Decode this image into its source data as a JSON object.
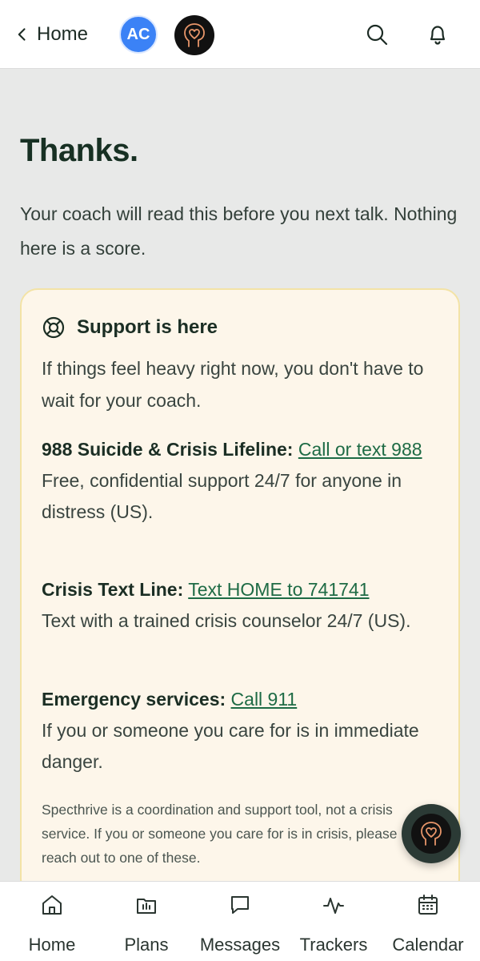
{
  "topbar": {
    "back_label": "Home",
    "avatar_initials": "AC",
    "avatar_color": "#3b82f6",
    "icons": [
      "chevron-left-icon",
      "search-icon",
      "bell-icon"
    ]
  },
  "main": {
    "title": "Thanks.",
    "subtitle": "Your coach will read this before you next talk. Nothing here is a score."
  },
  "support_card": {
    "title": "Support is here",
    "intro": "If things feel heavy right now, you don't have to wait for your coach.",
    "resources": [
      {
        "label": "988 Suicide & Crisis Lifeline:",
        "link": "Call or text 988",
        "description": "Free, confidential support 24/7 for anyone in distress (US)."
      },
      {
        "label": "Crisis Text Line:",
        "link": "Text HOME to 741741",
        "description": "Text with a trained crisis counselor 24/7 (US)."
      },
      {
        "label": "Emergency services:",
        "link": "Call 911",
        "description": "If you or someone you care for is in immediate danger."
      }
    ],
    "disclaimer": "Specthrive is a coordination and support tool, not a crisis service. If you or someone you care for is in crisis, please reach out to one of these."
  },
  "bottom_nav": {
    "items": [
      {
        "label": "Home",
        "icon": "home-icon"
      },
      {
        "label": "Plans",
        "icon": "plans-icon"
      },
      {
        "label": "Messages",
        "icon": "message-icon"
      },
      {
        "label": "Trackers",
        "icon": "activity-icon"
      },
      {
        "label": "Calendar",
        "icon": "calendar-icon"
      }
    ]
  },
  "colors": {
    "page_bg": "#e8e9e8",
    "card_bg": "#fdf6ea",
    "card_border": "#f3e3a6",
    "link": "#1e6b45",
    "logo_stroke": "#e8966a"
  }
}
